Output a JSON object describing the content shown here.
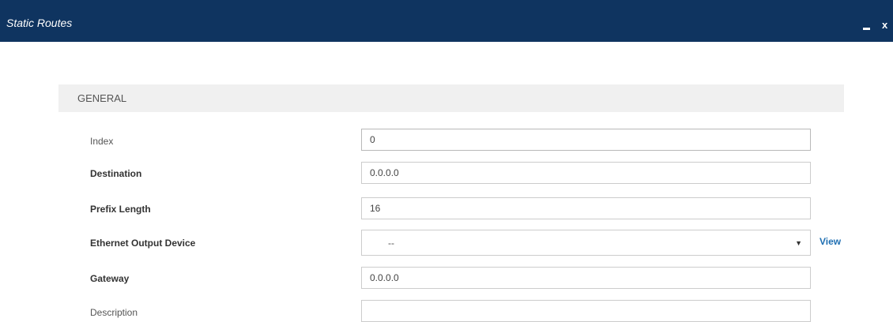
{
  "window": {
    "title": "Static Routes",
    "minimize_label": "-",
    "close_label": "x",
    "title_bar_color": "#0f3460"
  },
  "section": {
    "title": "GENERAL"
  },
  "fields": {
    "index": {
      "label": "Index",
      "value": "0"
    },
    "destination": {
      "label": "Destination",
      "value": "0.0.0.0"
    },
    "prefix_length": {
      "label": "Prefix Length",
      "value": "16"
    },
    "ethernet_output_device": {
      "label": "Ethernet Output Device",
      "value": "--",
      "link_label": "View"
    },
    "gateway": {
      "label": "Gateway",
      "value": "0.0.0.0"
    },
    "description": {
      "label": "Description",
      "value": ""
    }
  },
  "colors": {
    "link": "#1f6fb2",
    "section_background": "#f0f0f0"
  }
}
